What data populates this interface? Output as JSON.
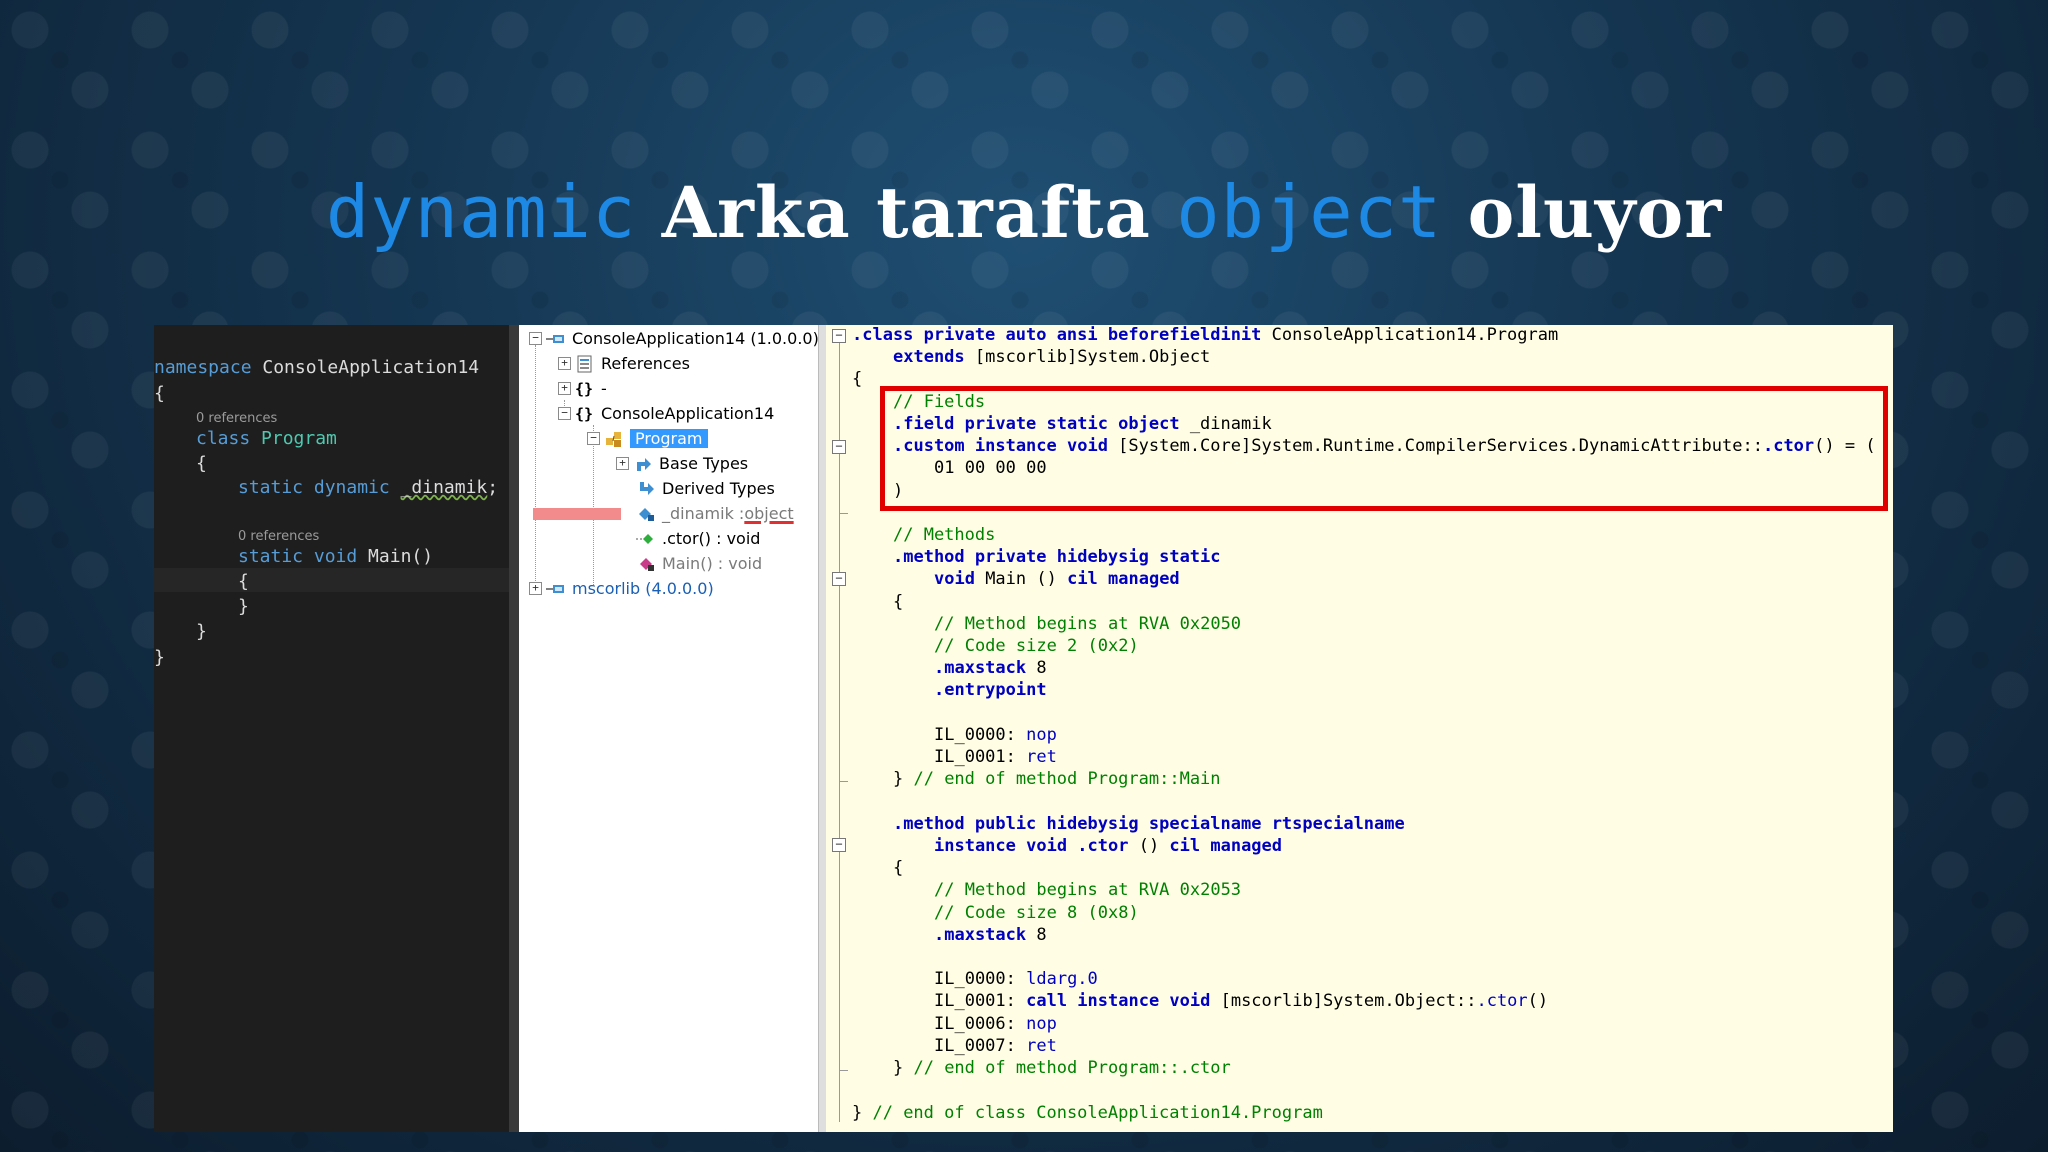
{
  "slide": {
    "title_kw1": "dynamic",
    "title_part1": " Arka tarafta ",
    "title_kw2": "object",
    "title_part2": " oluyor"
  },
  "vs_editor": {
    "namespace_kw": "namespace",
    "namespace_name": " ConsoleApplication14",
    "open_brace": "{",
    "refs0": "0 references",
    "class_kw": "class",
    "class_name": " Program",
    "brace2": "{",
    "static_kw": "static",
    "dynamic_kw": " dynamic",
    "field_name": "_dinamik",
    "semicolon": ";",
    "refs1": "0 references",
    "static_void_kw": "static void",
    "main_sig": " Main()",
    "brace3": "{",
    "brace4": "}",
    "brace5": "}",
    "brace6": "}"
  },
  "ildasm_tree": {
    "root": "ConsoleApplication14 (1.0.0.0)",
    "references": "References",
    "dash_ns": "-",
    "ns": "ConsoleApplication14",
    "program": "Program",
    "base_types": "Base Types",
    "derived_types": "Derived Types",
    "field_name": "_dinamik : ",
    "field_type": "object",
    "ctor": ".ctor() : void",
    "main": "Main() : void",
    "mscorlib": "mscorlib (4.0.0.0)",
    "plus": "+",
    "minus": "−"
  },
  "il_code": {
    "l01a": ".class private auto ansi beforefieldinit",
    "l01b": " ConsoleApplication14.Program",
    "l02a": "extends",
    "l02b": " [mscorlib]System.Object",
    "l03": "{",
    "l04": "// Fields",
    "l05a": ".field private static object",
    "l05b": " _dinamik",
    "l06a": ".custom instance void",
    "l06b": " [System.Core]System.Runtime.CompilerServices.DynamicAttribute::",
    "l06c": ".ctor",
    "l06d": "() = (",
    "l07": "01 00 00 00",
    "l08": ")",
    "l09": "// Methods",
    "l10": ".method private hidebysig static",
    "l11a": "void",
    "l11b": " Main () ",
    "l11c": "cil managed",
    "l12": "{",
    "l13": "// Method begins at RVA 0x2050",
    "l14": "// Code size 2 (0x2)",
    "l15a": ".maxstack",
    "l15b": " 8",
    "l16": ".entrypoint",
    "l17a": "IL_0000: ",
    "l17b": "nop",
    "l18a": "IL_0001: ",
    "l18b": "ret",
    "l19a": "} ",
    "l19b": "// end of method Program::Main",
    "l20": ".method public hidebysig specialname rtspecialname",
    "l21a": "instance void .ctor",
    "l21b": " () ",
    "l21c": "cil managed",
    "l22": "{",
    "l23": "// Method begins at RVA 0x2053",
    "l24": "// Code size 8 (0x8)",
    "l25a": ".maxstack",
    "l25b": " 8",
    "l26a": "IL_0000: ",
    "l26b": "ldarg.0",
    "l27a": "IL_0001: ",
    "l27b": "call instance void",
    "l27c": " [mscorlib]System.Object::",
    "l27d": ".ctor",
    "l27e": "()",
    "l28a": "IL_0006: ",
    "l28b": "nop",
    "l29a": "IL_0007: ",
    "l29b": "ret",
    "l30a": "} ",
    "l30b": "// end of method Program::.ctor",
    "l31a": "} ",
    "l31b": "// end of class ConsoleApplication14.Program",
    "fold_sign": "−"
  }
}
